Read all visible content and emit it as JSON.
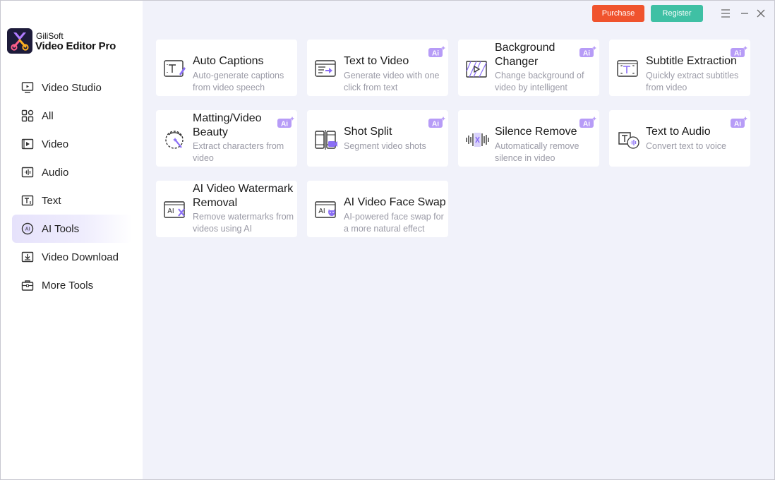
{
  "app": {
    "brand_top": "GiliSoft",
    "brand_main": "Video Editor Pro",
    "accent": "#7b5cf0"
  },
  "topbar": {
    "purchase_label": "Purchase",
    "register_label": "Register",
    "purchase_color": "#f0532d",
    "register_color": "#3fc0a4"
  },
  "sidebar": {
    "items": [
      {
        "label": "Video Studio",
        "icon": "monitor-icon"
      },
      {
        "label": "All",
        "icon": "grid-icon"
      },
      {
        "label": "Video",
        "icon": "video-play-icon"
      },
      {
        "label": "Audio",
        "icon": "audio-icon"
      },
      {
        "label": "Text",
        "icon": "text-icon"
      },
      {
        "label": "AI Tools",
        "icon": "ai-icon",
        "active": true
      },
      {
        "label": "Video Download",
        "icon": "download-icon"
      },
      {
        "label": "More Tools",
        "icon": "toolbox-icon"
      }
    ]
  },
  "tools": [
    {
      "title": "Auto Captions",
      "desc": "Auto-generate captions from video speech",
      "ai": false,
      "icon": "captions-icon"
    },
    {
      "title": "Text to Video",
      "desc": "Generate video with one click from text",
      "ai": true,
      "icon": "text-to-video-icon"
    },
    {
      "title": "Background Changer",
      "desc": "Change background of video by intelligent",
      "ai": true,
      "icon": "background-icon"
    },
    {
      "title": "Subtitle Extraction",
      "desc": "Quickly extract subtitles from video",
      "ai": true,
      "icon": "subtitle-icon"
    },
    {
      "title": "Matting/Video Beauty",
      "desc": "Extract characters from video",
      "ai": true,
      "icon": "matting-icon"
    },
    {
      "title": "Shot Split",
      "desc": "Segment video shots",
      "ai": true,
      "icon": "shot-split-icon"
    },
    {
      "title": "Silence Remove",
      "desc": "Automatically remove silence in video",
      "ai": true,
      "icon": "silence-icon"
    },
    {
      "title": "Text to Audio",
      "desc": "Convert text to voice",
      "ai": true,
      "icon": "text-to-audio-icon"
    },
    {
      "title": "AI Video Watermark Removal",
      "desc": "Remove watermarks from videos using AI",
      "ai": false,
      "icon": "watermark-icon"
    },
    {
      "title": "AI Video Face Swap",
      "desc": "AI-powered face swap for a more natural effect",
      "ai": false,
      "icon": "face-swap-icon"
    }
  ],
  "ai_badge_text": "Ai"
}
